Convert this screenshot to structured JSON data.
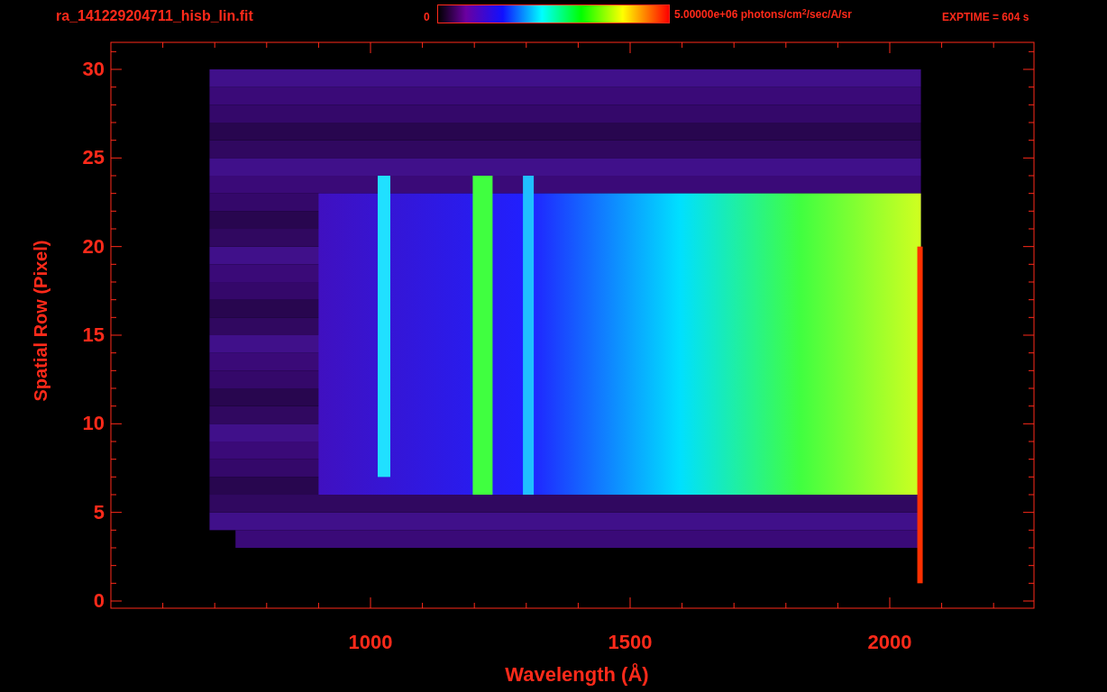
{
  "title": "ra_141229204711_hisb_lin.fit",
  "colorbar": {
    "min_label": "0",
    "max_label": "5.00000e+06 photons/cm$^{2}$/sec/A/sr"
  },
  "exposure": "EXPTIME = 604 s",
  "plot": {
    "xlabel": "Wavelength (Å)",
    "ylabel": "Spatial Row (Pixel)",
    "xticks": [
      "1000",
      "1500",
      "2000"
    ],
    "yticks": [
      "30",
      "25",
      "20",
      "15",
      "10",
      "5",
      "0"
    ]
  }
}
